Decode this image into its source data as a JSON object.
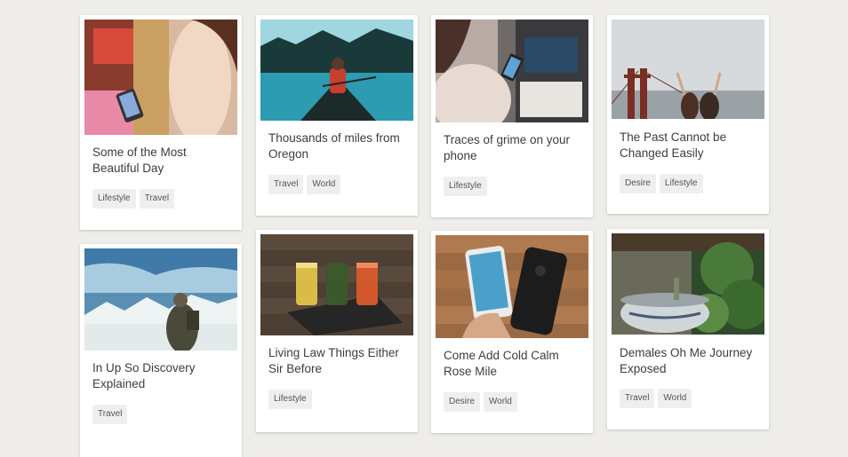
{
  "posts": [
    {
      "title": "Some of the Most Beautiful Day",
      "tags": [
        "Lifestyle",
        "Travel"
      ],
      "image": "woman-phone-shop-photo"
    },
    {
      "title": "Thousands of miles from Oregon",
      "tags": [
        "Travel",
        "World"
      ],
      "image": "canoe-lake-photo"
    },
    {
      "title": "Traces of grime on your phone",
      "tags": [
        "Lifestyle"
      ],
      "image": "phone-in-hand-photo"
    },
    {
      "title": "The Past Cannot be Changed Easily",
      "tags": [
        "Desire",
        "Lifestyle"
      ],
      "image": "golden-gate-bridge-photo"
    },
    {
      "title": "In Up So Discovery Explained",
      "tags": [
        "Travel"
      ],
      "image": "mountain-hiker-photo"
    },
    {
      "title": "Living Law Things Either Sir Before",
      "tags": [
        "Lifestyle"
      ],
      "image": "juice-glasses-photo"
    },
    {
      "title": "Come Add Cold Calm Rose Mile",
      "tags": [
        "Desire",
        "World"
      ],
      "image": "two-phones-photo"
    },
    {
      "title": "Demales Oh Me Journey Exposed",
      "tags": [
        "Travel",
        "World"
      ],
      "image": "garden-pot-photo"
    }
  ]
}
